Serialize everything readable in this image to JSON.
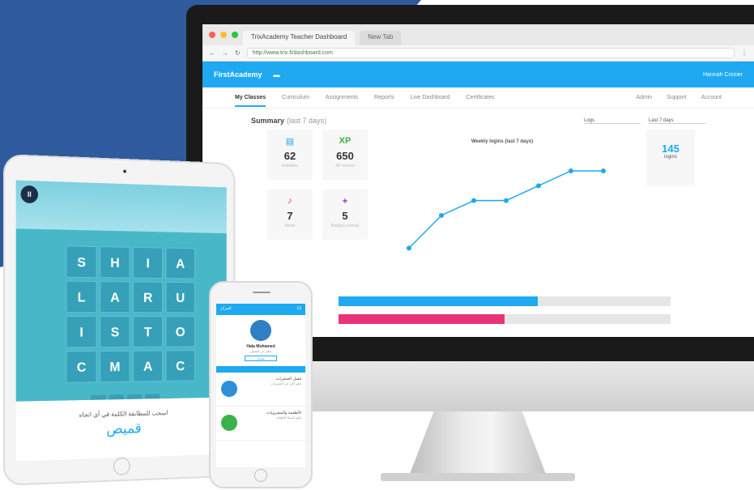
{
  "browser": {
    "tabs": [
      "TrixAcademy Teacher Dashboard",
      "New Tab"
    ],
    "url": "http://www.trix.fi/dashboard.com"
  },
  "app": {
    "logo": "FirstAcademy",
    "user": "Hannah Crozier",
    "nav": [
      "My Classes",
      "Curriculum",
      "Assignments",
      "Reports",
      "Live Dashboard",
      "Certificates"
    ],
    "nav_right": [
      "Admin",
      "Support",
      "Account"
    ]
  },
  "summary": {
    "title": "Summary",
    "period": "(last 7 days)",
    "select1": "Logs",
    "select2": "Last 7 days"
  },
  "stats": [
    {
      "icon": "stack-icon",
      "value": "62",
      "label": "Activities"
    },
    {
      "icon": "xp-icon",
      "value": "650",
      "label": "XP earned"
    },
    {
      "icon": "bell-icon",
      "value": "7",
      "label": "Alerts"
    },
    {
      "icon": "medal-icon",
      "value": "5",
      "label": "Badges earned"
    }
  ],
  "stat_xp_text": "XP",
  "logins": {
    "value": "145",
    "label": "logins"
  },
  "chart_data": {
    "type": "line",
    "title": "Weekly logins (last 7 days)",
    "x": [
      "1",
      "2",
      "3",
      "4",
      "5",
      "6",
      "7",
      "8"
    ],
    "values": [
      1,
      12,
      17,
      17,
      22,
      27,
      27
    ],
    "ylim": [
      0,
      30
    ],
    "grid": false
  },
  "progress": [
    {
      "color": "#1ea9f0",
      "value": 0.6
    },
    {
      "color": "#e8337a",
      "value": 0.5
    }
  ],
  "ipad": {
    "pause": "II",
    "grid": [
      "S",
      "H",
      "I",
      "A",
      "L",
      "A",
      "R",
      "U",
      "I",
      "S",
      "T",
      "O",
      "C",
      "M",
      "A",
      "C"
    ],
    "instruction": "اسحب للمطابقة الكلمة في أي اتجاه",
    "word": "قميص"
  },
  "iphone": {
    "nav_left": "المركز",
    "nav_right": "13",
    "name": "Hala Mohamed",
    "sub": "تعلم عن المغول",
    "button": "تعديل",
    "cards": [
      {
        "title": "فصل الحشرات",
        "desc": "تعلم أكثر عن الحشرات",
        "color": "#2e8fd8"
      },
      {
        "title": "الأطعمة والمشروبات",
        "desc": "تعلم أسماء الطعام",
        "color": "#3bb24a"
      }
    ]
  }
}
